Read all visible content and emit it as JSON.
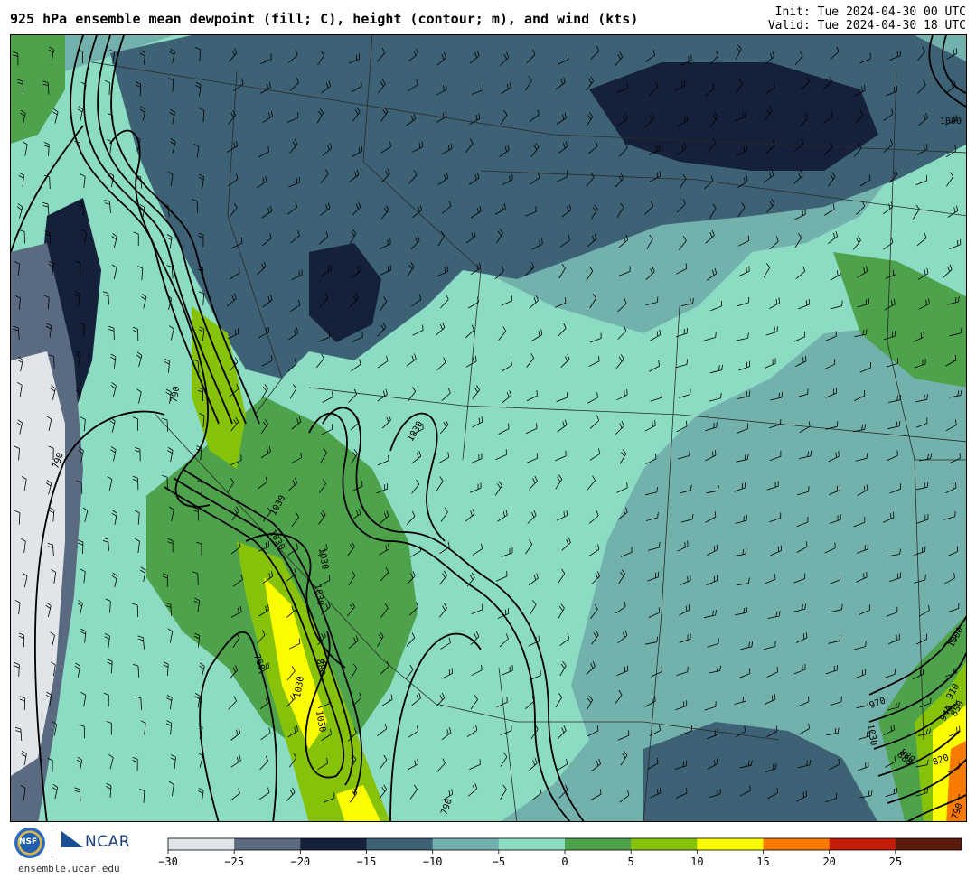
{
  "header": {
    "title": "925 hPa ensemble mean dewpoint (fill; C), height (contour; m), and wind (kts)",
    "init": "Init: Tue 2024-04-30 00 UTC",
    "valid": "Valid: Tue 2024-04-30 18 UTC"
  },
  "footer": {
    "website": "ensemble.ucar.edu",
    "logos": [
      {
        "name": "NSF",
        "icon": "nsf-logo-icon"
      },
      {
        "name": "NCAR",
        "icon": "ncar-logo-icon"
      }
    ]
  },
  "colorbar": {
    "ticks": [
      "−30",
      "−25",
      "−20",
      "−15",
      "−10",
      "−5",
      "0",
      "5",
      "10",
      "15",
      "20",
      "25"
    ],
    "bins": [
      {
        "from": -30,
        "to": -25,
        "color": "#e1e4e8"
      },
      {
        "from": -25,
        "to": -20,
        "color": "#5a6a80"
      },
      {
        "from": -20,
        "to": -15,
        "color": "#15203b"
      },
      {
        "from": -15,
        "to": -10,
        "color": "#3d6275"
      },
      {
        "from": -10,
        "to": -5,
        "color": "#73b1ac"
      },
      {
        "from": -5,
        "to": 0,
        "color": "#8cdcc4"
      },
      {
        "from": 0,
        "to": 5,
        "color": "#4ea24b"
      },
      {
        "from": 5,
        "to": 10,
        "color": "#86c20a"
      },
      {
        "from": 10,
        "to": 15,
        "color": "#fcfc00"
      },
      {
        "from": 15,
        "to": 20,
        "color": "#f87a00"
      },
      {
        "from": 20,
        "to": 25,
        "color": "#c21d06"
      },
      {
        "from": 25,
        "to": 30,
        "color": "#5b1a0e"
      }
    ]
  },
  "map": {
    "contour_labels": [
      "790",
      "790",
      "760",
      "1030",
      "1030",
      "1030",
      "1030",
      "1030",
      "1030",
      "1030",
      "880",
      "880",
      "910",
      "940",
      "970",
      "1000",
      "1000",
      "850",
      "820",
      "790",
      "880",
      "1030",
      "790"
    ]
  }
}
